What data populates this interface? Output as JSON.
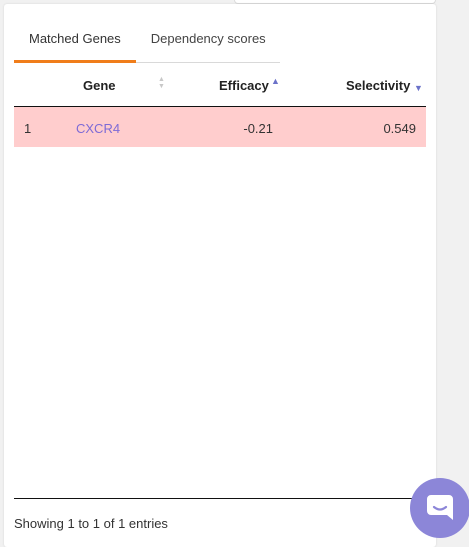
{
  "tabs": [
    {
      "label": "Matched Genes",
      "active": true
    },
    {
      "label": "Dependency scores",
      "active": false
    }
  ],
  "table": {
    "columns": {
      "gene": "Gene",
      "efficacy": "Efficacy",
      "selectivity": "Selectivity"
    },
    "rows": [
      {
        "index": "1",
        "gene": "CXCR4",
        "efficacy": "-0.21",
        "selectivity": "0.549"
      }
    ],
    "sort": {
      "efficacy": "ascending",
      "selectivity": "descending"
    }
  },
  "footer": {
    "info": "Showing 1 to 1 of 1 entries"
  },
  "colors": {
    "accent_tab": "#f07d1a",
    "row_highlight": "#ffcdcd",
    "link": "#7e6bd6",
    "chat_button": "#8c86d8"
  },
  "icons": {
    "chat": "chat-bubble-icon",
    "sort_neutral": "sort-both-icon",
    "sort_asc": "sort-up-icon",
    "sort_desc": "sort-down-icon"
  }
}
